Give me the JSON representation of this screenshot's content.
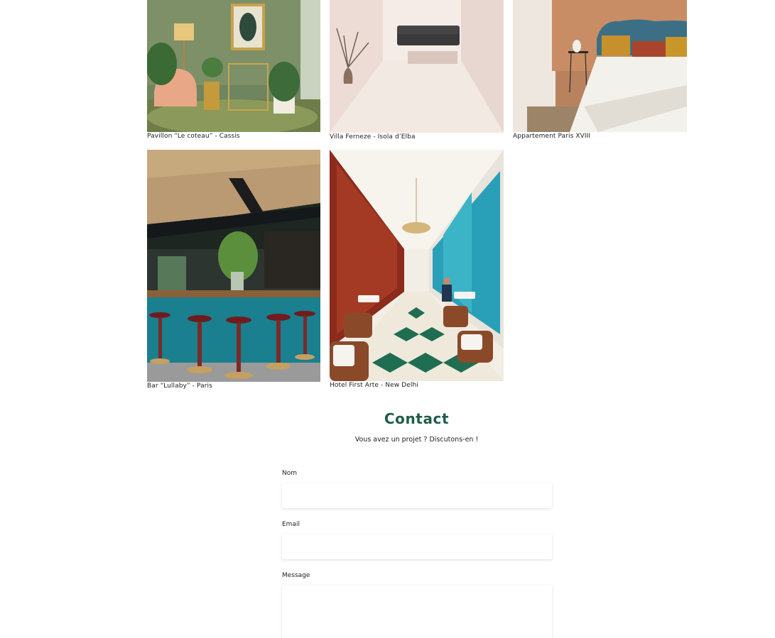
{
  "gallery": {
    "items": [
      {
        "caption": "Pavillon “Le coteau” - Cassis"
      },
      {
        "caption": "Villa Ferneze - Isola d’Elba"
      },
      {
        "caption": "Appartement Paris XVIII"
      },
      {
        "caption": "Bar “Lullaby” - Paris"
      },
      {
        "caption": "Hotel First Arte - New Delhi"
      }
    ]
  },
  "contact": {
    "title": "Contact",
    "subtitle": "Vous avez un projet ? Discutons-en !",
    "fields": {
      "name_label": "Nom",
      "name_value": "",
      "email_label": "Email",
      "email_value": "",
      "message_label": "Message",
      "message_value": ""
    }
  },
  "colors": {
    "accent": "#1f5c4b"
  }
}
